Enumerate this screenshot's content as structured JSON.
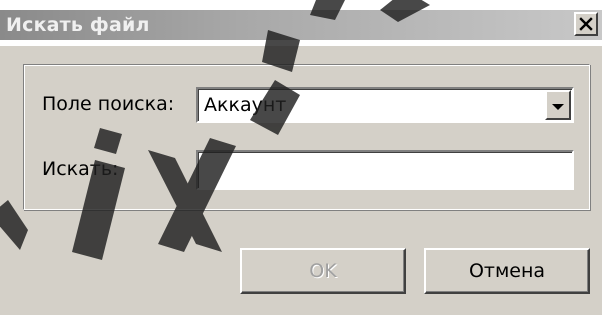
{
  "window": {
    "title": "Искать файл",
    "close_glyph": "✕"
  },
  "form": {
    "field_label": "Поле поиска:",
    "field_value": "Аккаунт",
    "search_label": "Искать:",
    "search_value": ""
  },
  "buttons": {
    "ok_label": "OK",
    "ok_enabled": false,
    "cancel_label": "Отмена"
  },
  "icons": {
    "close": "close-icon",
    "dropdown": "chevron-down-icon"
  },
  "colors": {
    "face": "#d4d0c8",
    "disabled_text": "#a0a0a0",
    "watermark": "#202020"
  }
}
